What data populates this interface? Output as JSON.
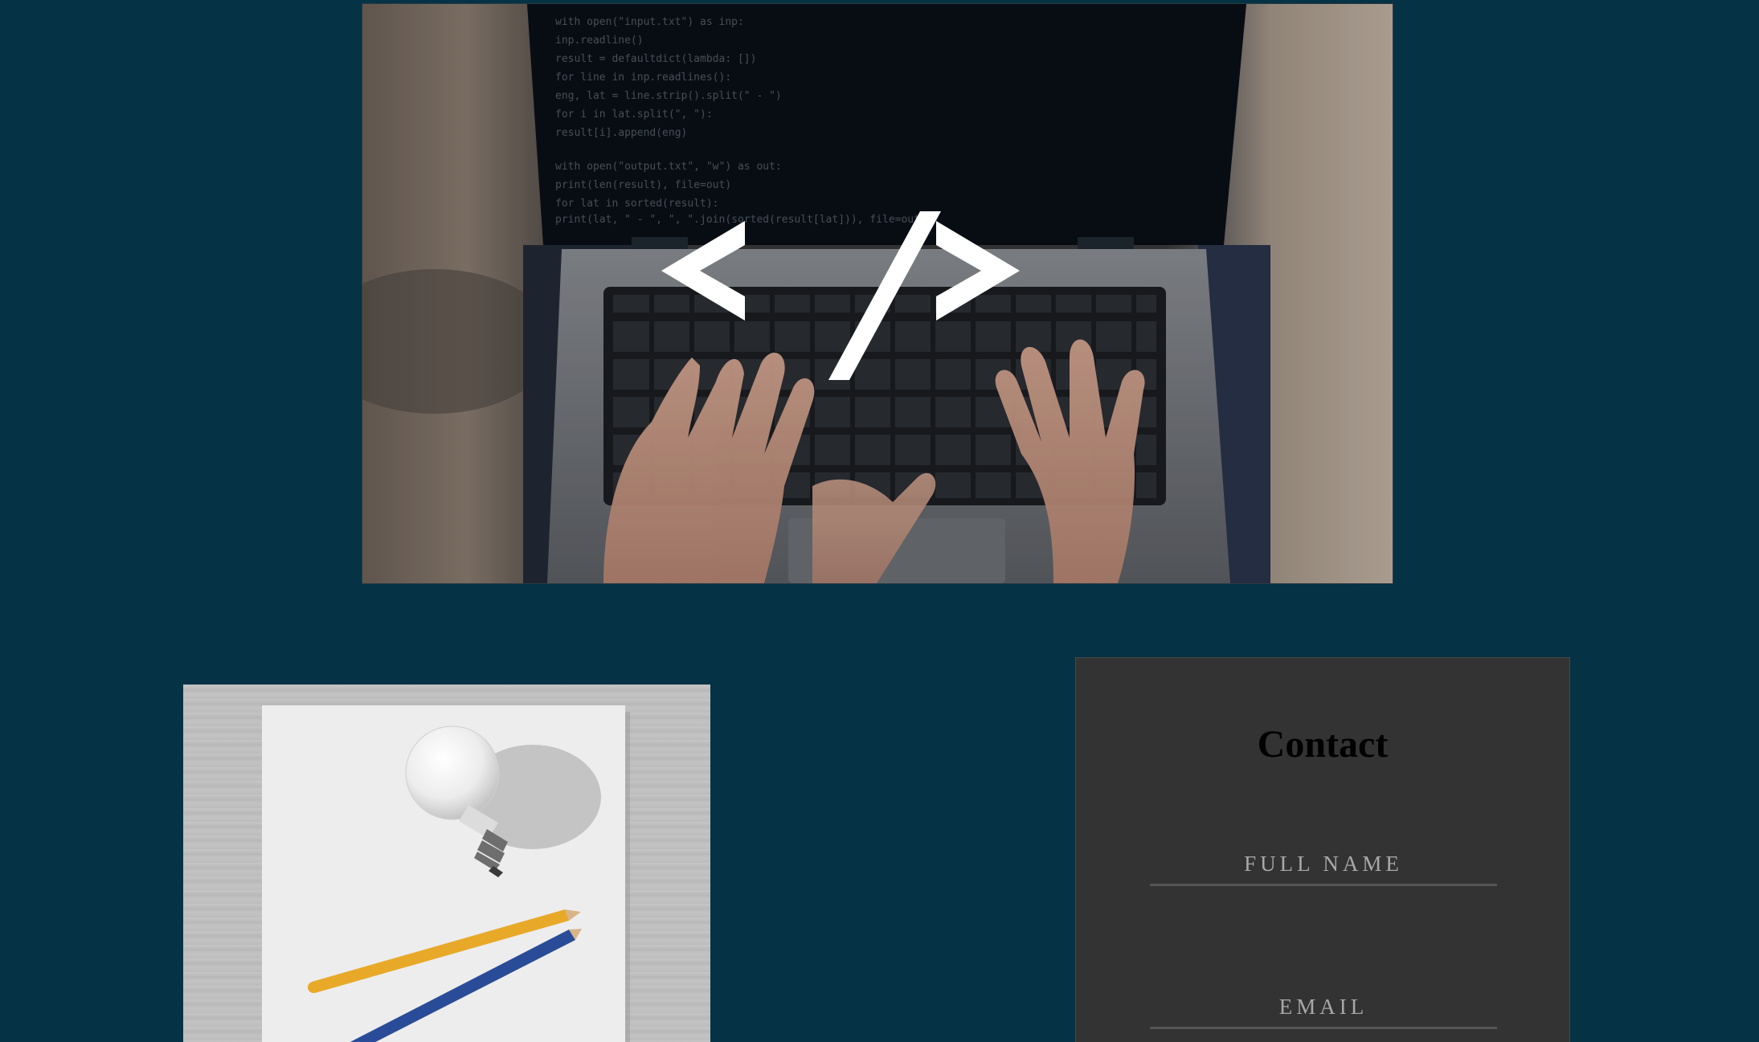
{
  "hero": {
    "icon": "code-tag-icon",
    "screen_code": [
      "with open(\"input.txt\") as inp:",
      "  inp.readline()",
      "  result = defaultdict(lambda: [])",
      "  for line in inp.readlines():",
      "    eng, lat = line.strip().split(\" - \")",
      "    for i in lat.split(\", \"):",
      "      result[i].append(eng)",
      "",
      "with open(\"output.txt\", \"w\") as out:",
      "  print(len(result), file=out)",
      "  for lat in sorted(result):",
      "    print(lat, \" - \", \", \".join(sorted(result[lat])), file=out)"
    ]
  },
  "idea_image": {
    "icon": "lightbulb-pencils-icon"
  },
  "contact": {
    "title": "Contact",
    "full_name_placeholder": "FULL NAME",
    "email_placeholder": "EMAIL"
  },
  "colors": {
    "page_background": "#053244",
    "card_background": "#333333",
    "field_underline": "#555555",
    "placeholder_text": "#a8a8a8"
  }
}
